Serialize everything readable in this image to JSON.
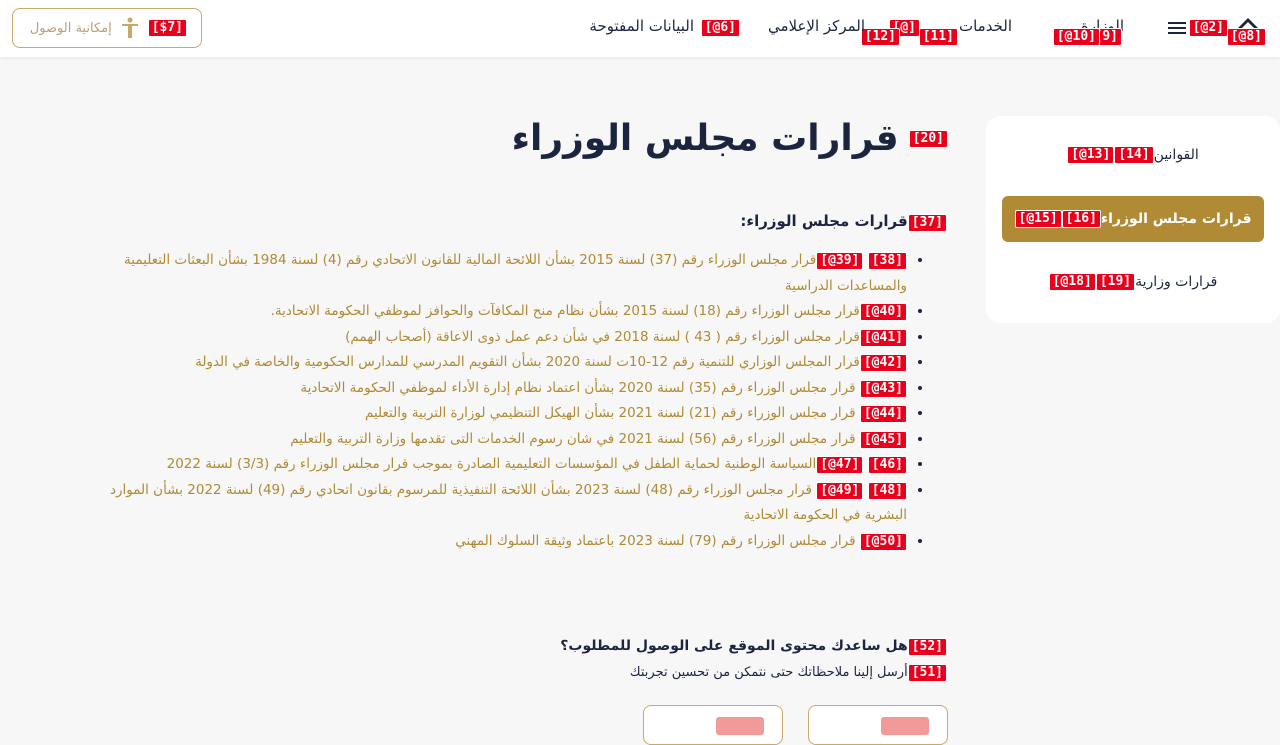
{
  "header": {
    "nav": [
      "البيانات المفتوحة",
      "المركز الإعلامي",
      "الخدمات",
      "الوزارة"
    ],
    "accessibility_label": "إمكانية الوصول"
  },
  "tags": {
    "t2": "[@2]",
    "t6": "[@6]",
    "t7": "[$7]",
    "t8": "[@8]",
    "t9": "[9]",
    "t10": "[@10]",
    "t11": "[11]",
    "t12": "[12]",
    "tnav": "[@]",
    "t13": "[@13]",
    "t14": "[14]",
    "t15": "[@15]",
    "t16": "[16]",
    "t18": "[@18]",
    "t19": "[19]",
    "t20": "[20]",
    "t37": "[37]",
    "t38": "[38]",
    "t39": "[@39]",
    "t40": "[@40]",
    "t41": "[@41]",
    "t42": "[@42]",
    "t43": "[@43]",
    "t44": "[@44]",
    "t45": "[@45]",
    "t46": "[46]",
    "t47": "[@47]",
    "t48": "[48]",
    "t49": "[@49]",
    "t50": "[@50]",
    "t51": "[51]",
    "t52": "[52]"
  },
  "sidebar": {
    "items": [
      "القوانين",
      "قرارات مجلس الوزراء",
      "قرارات وزارية"
    ],
    "active_index": 1
  },
  "main": {
    "title": "قرارات مجلس الوزراء",
    "section_heading": "قرارات مجلس الوزراء:",
    "decisions": [
      "قرار مجلس الوزراء رقم (37) لسنة 2015 بشأن اللائحة المالية للقانون الاتحادي رقم (4) لسنة 1984 بشأن البعثات التعليمية والمساعدات الدراسية",
      "قرار مجلس الوزراء رقم (18) لسنة 2015 بشأن نظام منح المكافآت والحوافز لموظفي الحكومة الاتحادية.",
      "قرار مجلس الوزراء رقم ( 43 ) لسنة 2018 في شأن دعم عمل ذوى الاعاقة (أصحاب الهمم)",
      "قرار المجلس الوزاري للتنمية رقم 12-10ت لسنة 2020 بشأن التقويم المدرسي للمدارس الحكومية والخاصة في الدولة",
      "قرار مجلس الوزراء رقم (35) لسنة 2020 بشأن اعتماد نظام إدارة الأداء لموظفي الحكومة الاتحادية",
      "قرار مجلس الوزراء رقم (21) لسنة 2021 بشأن الهيكل التنظيمي لوزارة التربية والتعليم",
      "قرار مجلس الوزراء رقم (56) لسنة 2021 في شان رسوم الخدمات التى تقدمها وزارة التربية والتعليم",
      "السياسة الوطنية لحماية الطفل في المؤسسات التعليمية الصادرة بموجب قرار مجلس الوزراء رقم (3/3) لسنة 2022",
      "قرار مجلس الوزراء رقم (48) لسنة 2023 بشأن اللائحة التنفيذية للمرسوم بقانون اتحادي رقم (49) لسنة 2022 بشأن الموارد البشرية في الحكومة الاتحادية",
      "قرار مجلس الوزراء رقم (79) لسنة 2023 باعتماد وثيقة السلوك المهني"
    ]
  },
  "feedback": {
    "question": "هل ساعدك محتوى الموقع على الوصول للمطلوب؟",
    "subtext": "أرسل إلينا ملاحظاتك حتى نتمكن من تحسين تجربتك"
  },
  "colors": {
    "accent": "#b08a35",
    "text": "#1b2540",
    "tag_bg": "#e8001c",
    "background": "#f7f7f7"
  }
}
